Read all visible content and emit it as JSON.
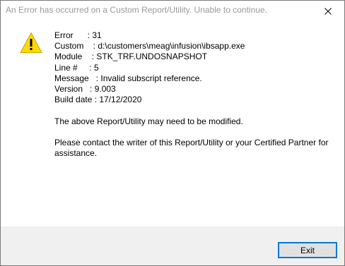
{
  "window": {
    "title": "An Error has occurred on a Custom Report/Utility. Unable to continue."
  },
  "message": {
    "icon": "warning-icon",
    "error_line": "Error      : 31",
    "custom_line": "Custom    : d:\\customers\\meag\\infusion\\ibsapp.exe",
    "module_line": "Module    : STK_TRF.UNDOSNAPSHOT",
    "line_line": "Line #     : 5",
    "message_line": "Message   : Invalid subscript reference.",
    "version_line": "Version   : 9.003",
    "build_line": "Build date : 17/12/2020",
    "note": "The above Report/Utility may need to be modified.",
    "contact": "Please contact the writer of this Report/Utility or your Certified Partner for assistance."
  },
  "buttons": {
    "exit": "Exit"
  },
  "colors": {
    "accent": "#0078d7",
    "warning_fill": "#ffd800",
    "footer_bg": "#f0f0f0"
  }
}
